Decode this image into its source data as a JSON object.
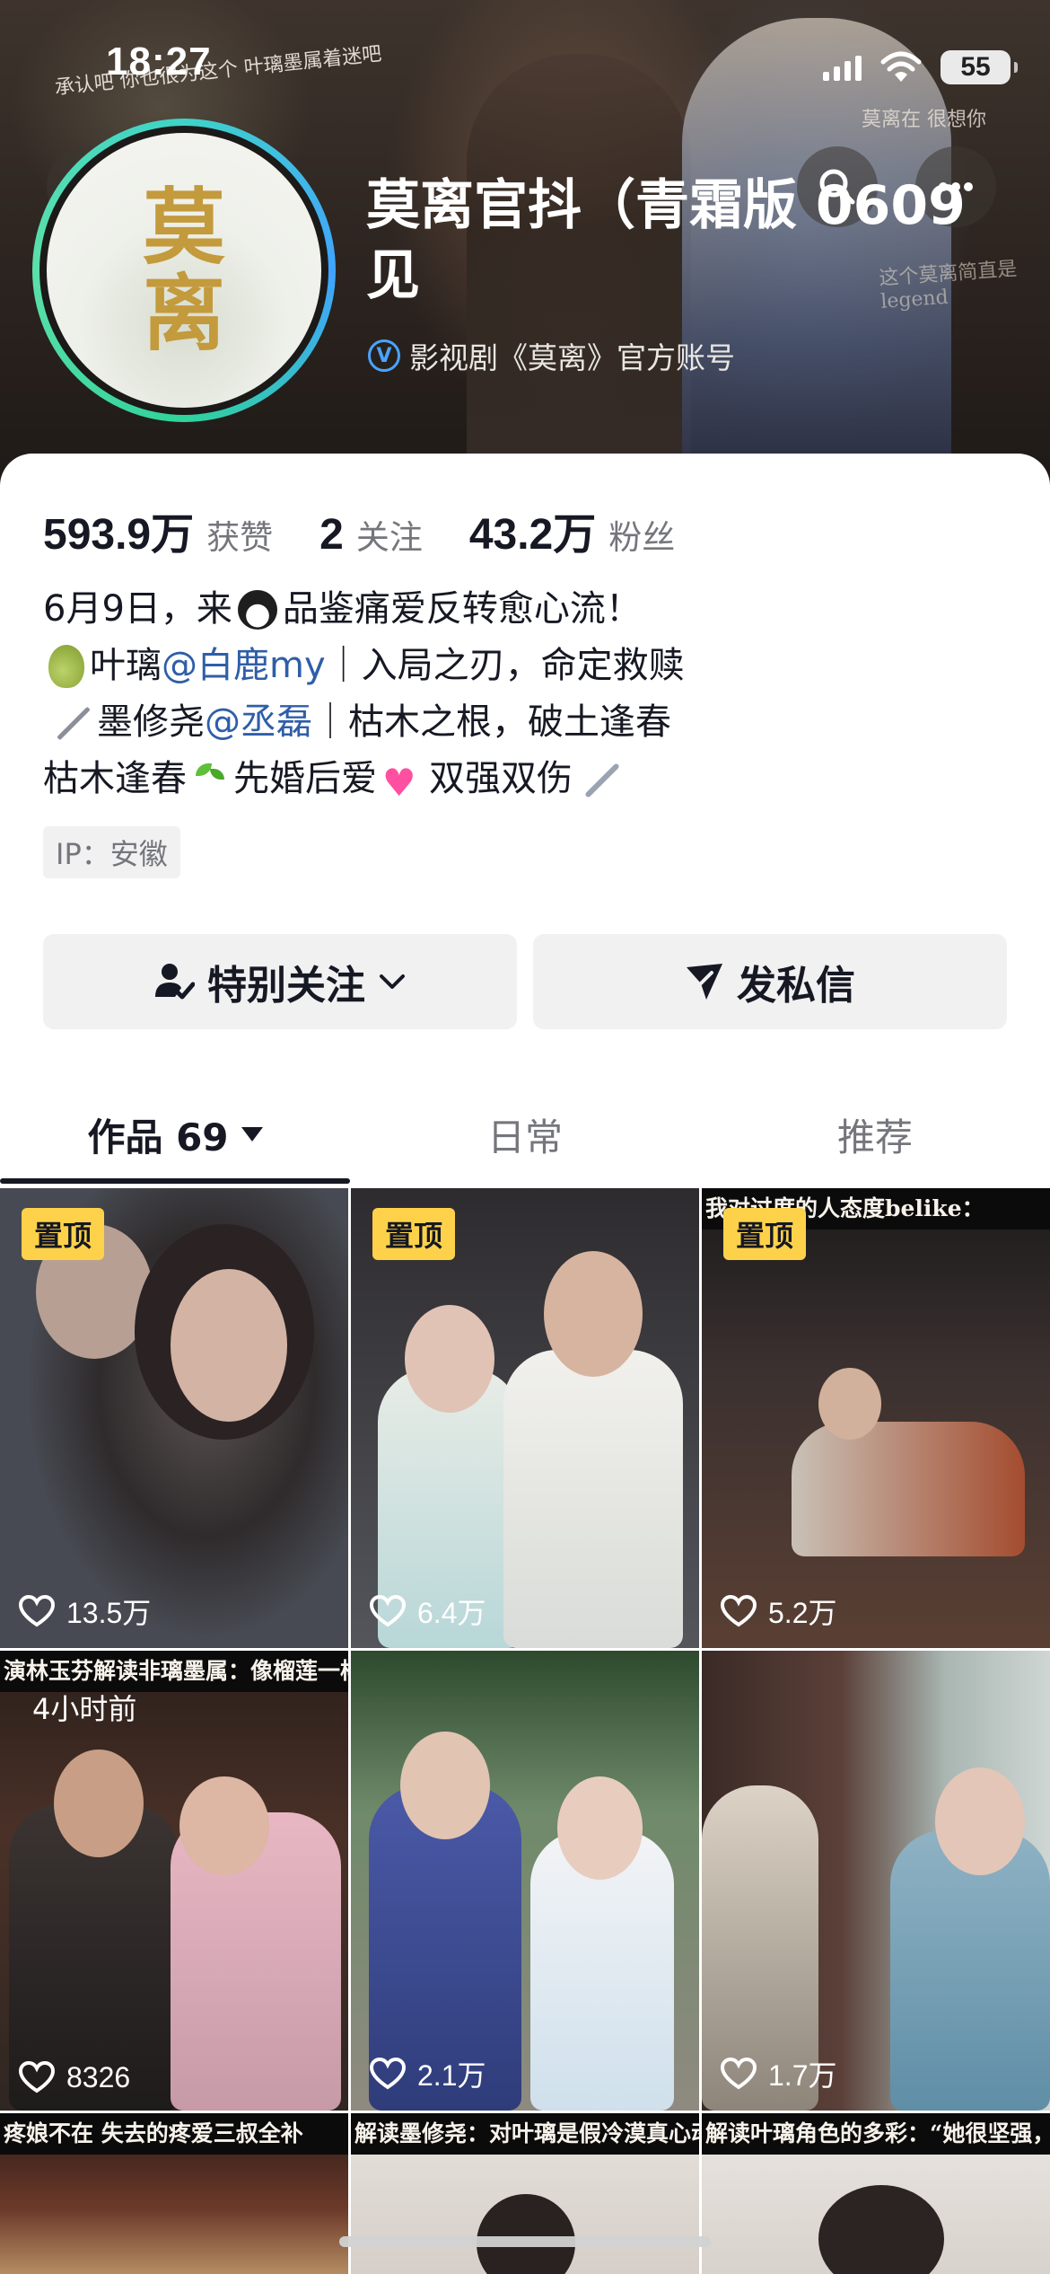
{
  "status_bar": {
    "time": "18:27",
    "battery": "55"
  },
  "banner": {
    "left_caption": "承认吧 你也很为这个 叶璃墨属着迷吧",
    "right_caption": "莫离在 很想你",
    "right_caption_2": "这个莫离简直是legend"
  },
  "profile": {
    "avatar_chars": [
      "莫",
      "离"
    ],
    "name": "莫离官抖（青霜版 0609 见",
    "verification": "影视剧《莫离》官方账号"
  },
  "stats": [
    {
      "value": "593.9万",
      "label": "获赞"
    },
    {
      "value": "2",
      "label": "关注"
    },
    {
      "value": "43.2万",
      "label": "粉丝"
    }
  ],
  "bio": {
    "line1_a": "6月9日，来",
    "line1_b": "品鉴痛爱反转愈心流！",
    "line2_a": "叶璃",
    "line2_mention": "@白鹿my",
    "line2_b": "｜入局之刃，命定救赎",
    "line3_a": "墨修尧",
    "line3_mention": "@丞磊",
    "line3_b": "｜枯木之根，破土逢春",
    "line4_a": "枯木逢春",
    "line4_b": "先婚后爱",
    "line4_c": "双强双伤"
  },
  "ip_tag": "IP：安徽",
  "actions": {
    "follow": "特别关注",
    "message": "发私信"
  },
  "tabs": [
    {
      "label": "作品 69"
    },
    {
      "label": "日常"
    },
    {
      "label": "推荐"
    }
  ],
  "videos": [
    {
      "likes": "13.5万",
      "badge": "置顶",
      "banner": "",
      "time": ""
    },
    {
      "likes": "6.4万",
      "badge": "置顶",
      "banner": "",
      "time": ""
    },
    {
      "likes": "5.2万",
      "badge": "置顶",
      "banner": "我对过度的人态度belike：",
      "time": ""
    },
    {
      "likes": "8326",
      "badge": "",
      "banner": "演林玉芬解读非璃墨属：像榴莲一样",
      "time": "4小时前"
    },
    {
      "likes": "2.1万",
      "badge": "",
      "banner": "",
      "time": ""
    },
    {
      "likes": "1.7万",
      "badge": "",
      "banner": "",
      "time": ""
    },
    {
      "likes": "",
      "badge": "",
      "banner": "疼娘不在 失去的疼爱三叔全补",
      "time": ""
    },
    {
      "likes": "",
      "badge": "",
      "banner": "解读墨修尧：对叶璃是假冷漠真心动",
      "time": ""
    },
    {
      "likes": "",
      "badge": "",
      "banner": "解读叶璃角色的多彩：“她很坚强，",
      "time": ""
    }
  ],
  "colors": {
    "accent_pin": "#fdd24a",
    "mention": "#2f5ea8",
    "verify": "#4aa3ff"
  }
}
